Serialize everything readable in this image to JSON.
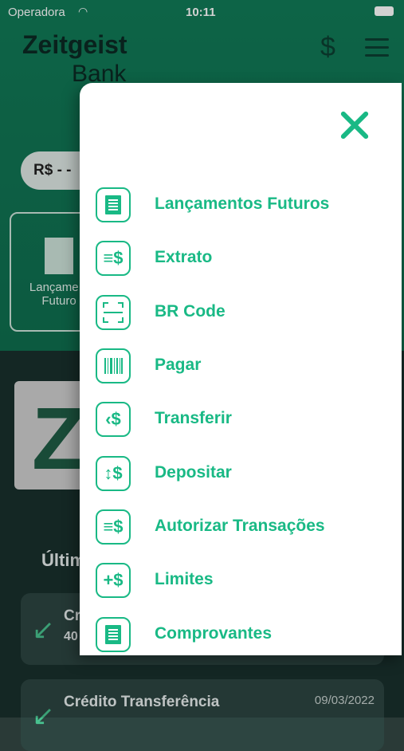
{
  "status_bar": {
    "carrier": "Operadora",
    "time": "10:11"
  },
  "header": {
    "logo_line1": "Zeitgeist",
    "logo_line2": "Bank",
    "dollar_symbol": "$"
  },
  "balance": {
    "text": "R$ - -"
  },
  "shortcut_card": {
    "label": "Lançame... Futuro"
  },
  "banner": {
    "letter": "Z"
  },
  "last_transactions": {
    "title": "Últim",
    "items": [
      {
        "name": "Cr",
        "amount": "40",
        "date": ""
      },
      {
        "name": "Crédito Transferência",
        "amount": "",
        "date": "09/03/2022"
      }
    ]
  },
  "menu": {
    "items": [
      {
        "label": "Lançamentos Futuros",
        "icon": "document-lines-icon"
      },
      {
        "label": "Extrato",
        "icon": "statement-dollar-icon"
      },
      {
        "label": "BR Code",
        "icon": "qr-scan-icon"
      },
      {
        "label": "Pagar",
        "icon": "barcode-icon"
      },
      {
        "label": "Transferir",
        "icon": "transfer-dollar-icon"
      },
      {
        "label": "Depositar",
        "icon": "deposit-dollar-icon"
      },
      {
        "label": "Autorizar Transações",
        "icon": "authorize-dollar-icon"
      },
      {
        "label": "Limites",
        "icon": "plus-dollar-icon"
      },
      {
        "label": "Comprovantes",
        "icon": "receipt-icon"
      }
    ]
  },
  "colors": {
    "accent": "#19b985",
    "header_bg": "#117a57",
    "dark_bg": "#19302d"
  }
}
